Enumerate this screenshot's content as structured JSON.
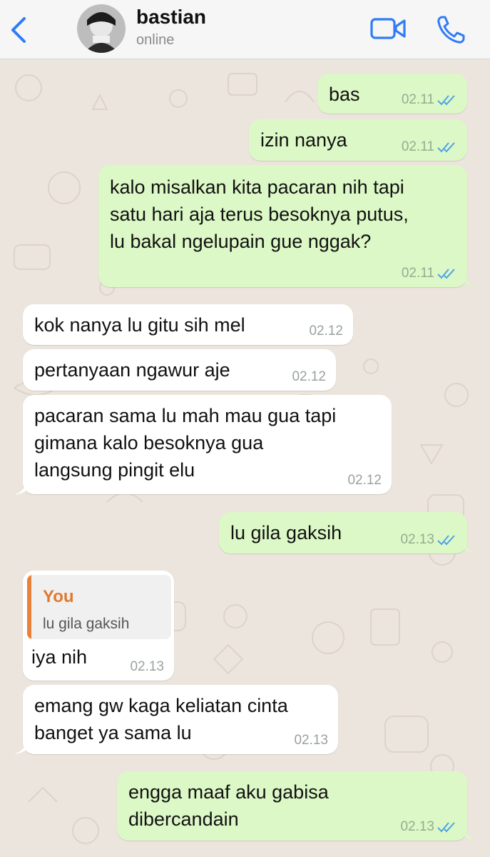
{
  "header": {
    "contact_name": "bastian",
    "status": "online",
    "icons": {
      "back": "chevron-left-icon",
      "video": "video-camera-icon",
      "call": "phone-icon"
    },
    "accent_color": "#2f7cf6"
  },
  "colors": {
    "outgoing_bubble": "#dcf8c6",
    "incoming_bubble": "#ffffff",
    "chat_background": "#ece5dd",
    "read_ticks": "#4fa3e6",
    "quote_name": "#e0792e"
  },
  "messages": [
    {
      "direction": "out",
      "lines": [
        "bas"
      ],
      "time": "02.11",
      "read": true
    },
    {
      "direction": "out",
      "lines": [
        "izin nanya"
      ],
      "time": "02.11",
      "read": true
    },
    {
      "direction": "out",
      "lines": [
        "kalo misalkan kita pacaran nih tapi",
        "satu hari aja terus besoknya putus,",
        "lu bakal ngelupain gue nggak?"
      ],
      "time": "02.11",
      "read": true
    },
    {
      "direction": "in",
      "lines": [
        "kok nanya lu gitu sih mel"
      ],
      "time": "02.12"
    },
    {
      "direction": "in",
      "lines": [
        "pertanyaan ngawur aje"
      ],
      "time": "02.12"
    },
    {
      "direction": "in",
      "lines": [
        "pacaran sama lu mah mau gua tapi",
        "gimana kalo besoknya gua",
        "langsung pingit elu"
      ],
      "time": "02.12"
    },
    {
      "direction": "out",
      "lines": [
        "lu gila gaksih"
      ],
      "time": "02.13",
      "read": true
    },
    {
      "direction": "in",
      "quote": {
        "author": "You",
        "text": "lu gila gaksih"
      },
      "lines": [
        "iya nih"
      ],
      "time": "02.13"
    },
    {
      "direction": "in",
      "lines": [
        "emang gw kaga keliatan cinta",
        "banget ya sama lu"
      ],
      "time": "02.13"
    },
    {
      "direction": "out",
      "lines": [
        "engga maaf aku gabisa",
        "dibercandain"
      ],
      "time": "02.13",
      "read": true
    }
  ]
}
